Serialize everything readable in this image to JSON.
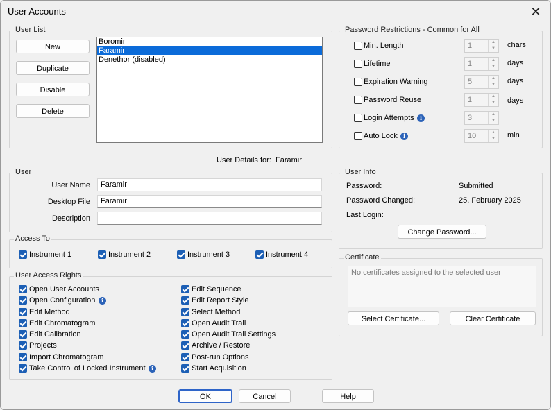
{
  "window": {
    "title": "User Accounts",
    "close_glyph": "✕"
  },
  "user_list": {
    "legend": "User List",
    "buttons": {
      "new": "New",
      "duplicate": "Duplicate",
      "disable": "Disable",
      "delete": "Delete"
    },
    "users": [
      "Boromir",
      "Faramir",
      "Denethor (disabled)"
    ],
    "selected": "Faramir"
  },
  "password_restrictions": {
    "legend": "Password Restrictions - Common for All",
    "rows": [
      {
        "label": "Min. Length",
        "value": "1",
        "unit": "chars",
        "checked": false
      },
      {
        "label": "Lifetime",
        "value": "1",
        "unit": "days",
        "checked": false
      },
      {
        "label": "Expiration Warning",
        "value": "5",
        "unit": "days",
        "checked": false
      },
      {
        "label": "Password Reuse",
        "value": "1",
        "unit": "days",
        "checked": false
      },
      {
        "label": "Login Attempts",
        "value": "3",
        "unit": "",
        "checked": false,
        "info": true
      },
      {
        "label": "Auto Lock",
        "value": "10",
        "unit": "min",
        "checked": false,
        "info": true
      }
    ]
  },
  "details_header": {
    "prefix": "User Details for:",
    "name": "Faramir"
  },
  "user": {
    "legend": "User",
    "user_name_label": "User Name",
    "user_name_value": "Faramir",
    "desktop_file_label": "Desktop File",
    "desktop_file_value": "Faramir",
    "description_label": "Description",
    "description_value": ""
  },
  "user_info": {
    "legend": "User Info",
    "password_label": "Password:",
    "password_value": "Submitted",
    "changed_label": "Password Changed:",
    "changed_value": "25. February 2025",
    "last_login_label": "Last Login:",
    "last_login_value": "",
    "change_password_button": "Change Password..."
  },
  "access_to": {
    "legend": "Access To",
    "instruments": [
      "Instrument 1",
      "Instrument 2",
      "Instrument 3",
      "Instrument 4"
    ]
  },
  "rights": {
    "legend": "User Access Rights",
    "left": [
      "Open User Accounts",
      "Open Configuration",
      "Edit Method",
      "Edit Chromatogram",
      "Edit Calibration",
      "Projects",
      "Import Chromatogram",
      "Take Control of Locked Instrument"
    ],
    "right": [
      "Edit Sequence",
      "Edit Report Style",
      "Select Method",
      "Open Audit Trail",
      "Open Audit Trail Settings",
      "Archive / Restore",
      "Post-run Options",
      "Start Acquisition"
    ]
  },
  "certificate": {
    "legend": "Certificate",
    "placeholder": "No certificates assigned to the selected user",
    "select_button": "Select Certificate...",
    "clear_button": "Clear Certificate"
  },
  "footer": {
    "ok": "OK",
    "cancel": "Cancel",
    "help": "Help"
  },
  "colors": {
    "accent": "#1c5fb5",
    "selection": "#0b6bd9",
    "info": "#2c63b8"
  },
  "icons": {
    "info": "info-icon",
    "close": "close-icon"
  }
}
